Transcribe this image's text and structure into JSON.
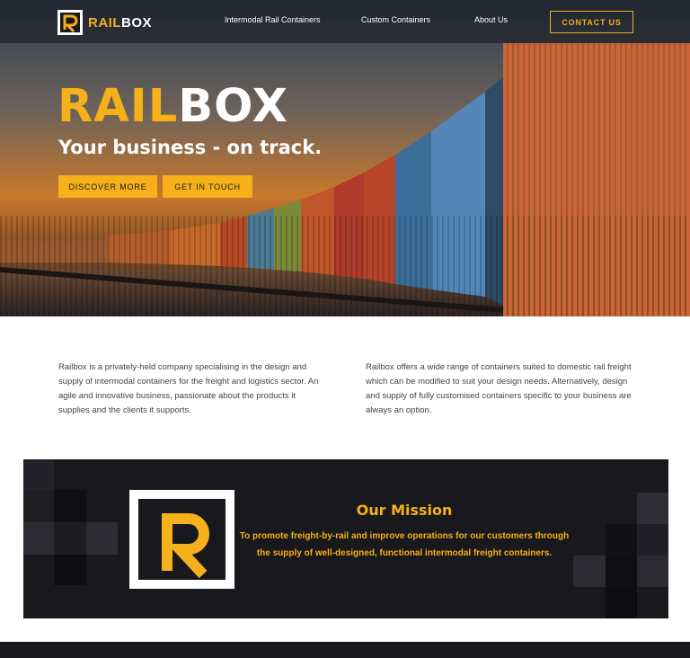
{
  "brand": {
    "name_part1": "RAIL",
    "name_part2": "BOX",
    "accent_color": "#f5b01a",
    "dark_color": "#18181d"
  },
  "nav": {
    "links": [
      "Intermodal Rail Containers",
      "Custom Containers",
      "About Us"
    ],
    "contact_label": "CONTACT US"
  },
  "hero": {
    "title_part1": "RAIL",
    "title_part2": "BOX",
    "subtitle": "Your business - on track.",
    "discover_label": "DISCOVER MORE",
    "touch_label": "GET IN TOUCH"
  },
  "intro": {
    "left": "Railbox is a privately-held company specialising in the design and supply of intermodal containers for the freight and logistics sector. An agile and innovative business, passionate about the products it supplies and the clients it supports.",
    "right": "Railbox offers a wide range of containers suited to domestic rail freight which can be modified to suit your design needs. Alternatively, design and supply of fully customised containers specific to your business are always an option."
  },
  "mission": {
    "title": "Our Mission",
    "text": "To promote freight-by-rail and improve operations for our customers through the supply of well-designed, functional intermodal freight containers."
  }
}
